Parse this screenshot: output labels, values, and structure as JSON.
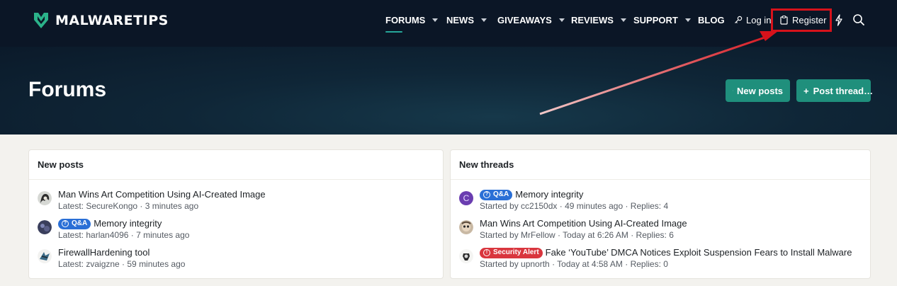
{
  "brand": {
    "name": "MALWARETIPS",
    "icon": "malwaretips-shield-logo",
    "accent": "#1f8f7c"
  },
  "nav": {
    "items": [
      {
        "label": "FORUMS",
        "dropdown": true,
        "active": true
      },
      {
        "label": "NEWS",
        "dropdown": true
      },
      {
        "label": "GIVEAWAYS",
        "dropdown": true
      },
      {
        "label": "REVIEWS",
        "dropdown": true
      },
      {
        "label": "SUPPORT",
        "dropdown": true
      },
      {
        "label": "BLOG",
        "dropdown": false
      }
    ],
    "login_label": "Log in",
    "login_icon": "key-icon",
    "register_label": "Register",
    "register_icon": "clipboard-icon",
    "whats_new_icon": "lightning-icon",
    "search_icon": "search-icon"
  },
  "hero": {
    "title": "Forums",
    "new_posts_label": "New posts",
    "post_thread_label": "Post thread…"
  },
  "new_posts": {
    "title": "New posts",
    "items": [
      {
        "title": "Man Wins Art Competition Using AI-Created Image",
        "badge": "",
        "meta": "Latest: SecureKongo · 3 minutes ago"
      },
      {
        "title": "Memory integrity",
        "badge": "Q&A",
        "meta": "Latest: harlan4096 · 7 minutes ago"
      },
      {
        "title": "FirewallHardening tool",
        "badge": "",
        "meta": "Latest: zvaigzne · 59 minutes ago"
      }
    ]
  },
  "new_threads": {
    "title": "New threads",
    "items": [
      {
        "title": "Memory integrity",
        "badge": "Q&A",
        "avatar_letter": "C",
        "meta": "Started by cc2150dx · 49 minutes ago · Replies: 4"
      },
      {
        "title": "Man Wins Art Competition Using AI-Created Image",
        "badge": "",
        "avatar_letter": "",
        "meta": "Started by MrFellow · Today at 6:26 AM · Replies: 6"
      },
      {
        "title": "Fake ‘YouTube’ DMCA Notices Exploit Suspension Fears to Install Malware",
        "badge": "Security Alert",
        "avatar_letter": "",
        "meta": "Started by upnorth · Today at 4:58 AM · Replies: 0"
      }
    ]
  },
  "colors": {
    "annotation_red": "#d6121b",
    "qa_badge": "#2a6fd6",
    "alert_badge": "#d9363e"
  }
}
